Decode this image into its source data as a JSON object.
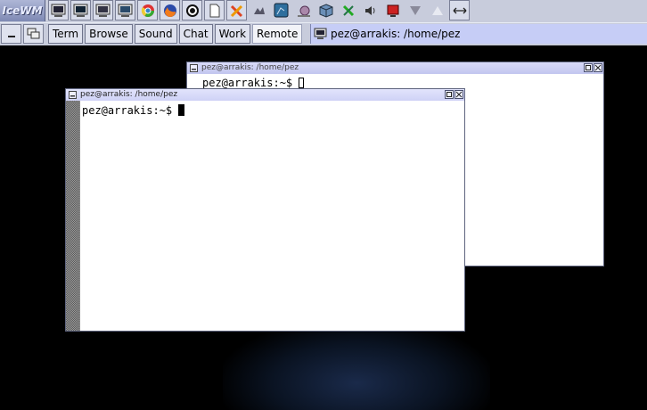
{
  "taskbar": {
    "start_label": "IceWM",
    "quick_launch": [
      {
        "name": "terminal-icon"
      },
      {
        "name": "terminal-icon"
      },
      {
        "name": "terminal-icon"
      },
      {
        "name": "terminal-icon"
      },
      {
        "name": "chrome-icon"
      },
      {
        "name": "firefox-icon"
      },
      {
        "name": "obs-icon"
      },
      {
        "name": "document-icon"
      },
      {
        "name": "tools-icon"
      },
      {
        "name": "game-icon"
      },
      {
        "name": "chart-icon"
      },
      {
        "name": "snail-icon"
      },
      {
        "name": "box-icon"
      },
      {
        "name": "wrench-icon"
      },
      {
        "name": "volume-icon"
      },
      {
        "name": "monitor-red-icon"
      },
      {
        "name": "arrow-down-icon"
      },
      {
        "name": "arrow-up-icon"
      },
      {
        "name": "resize-horizontal-icon"
      }
    ],
    "workspaces": [
      "Term",
      "Browse",
      "Sound",
      "Chat",
      "Work",
      "Remote"
    ],
    "active_workspace": "Remote",
    "task_title": "pez@arrakis: /home/pez"
  },
  "windows": {
    "back": {
      "title": "pez@arrakis: /home/pez",
      "prompt": "pez@arrakis:~$ "
    },
    "front": {
      "title": "pez@arrakis: /home/pez",
      "prompt": "pez@arrakis:~$ "
    }
  },
  "colors": {
    "taskbar_bg": "#c8ccdc",
    "titlebar": "#cfd2f6",
    "task_item": "#c6cdf6",
    "desktop": "#000000"
  }
}
